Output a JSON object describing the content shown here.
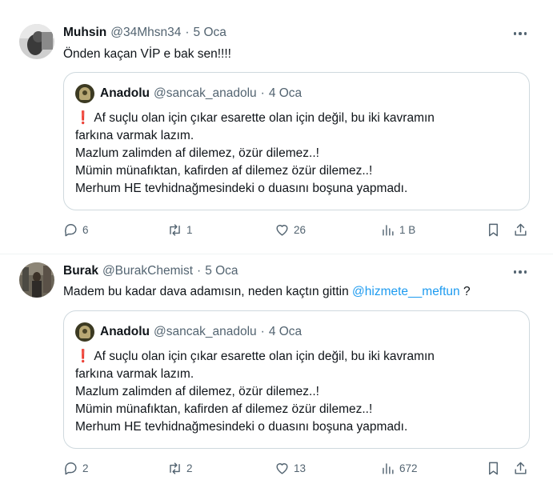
{
  "quoted": {
    "name": "Anadolu",
    "handle": "@sancak_anadolu",
    "date": "4 Oca",
    "lines": [
      "Af suçlu olan için çıkar esarette olan için değil, bu iki kavramın",
      "farkına varmak lazım.",
      "Mazlum zalimden af dilemez, özür dilemez..!",
      "Mümin münafıktan, kafirden af dilemez özür dilemez..!",
      "Merhum HE tevhidnağmesindeki o duasını boşuna yapmadı."
    ]
  },
  "tweets": [
    {
      "name": "Muhsin",
      "handle": "@34Mhsn34",
      "date": "5 Oca",
      "text": "Önden kaçan VİP e bak sen!!!!",
      "replies": "6",
      "reposts": "1",
      "likes": "26",
      "views": "1 B"
    },
    {
      "name": "Burak",
      "handle": "@BurakChemist",
      "date": "5 Oca",
      "text_before": "Madem bu kadar dava adamısın, neden kaçtın gittin",
      "mention": "@hizmete__meftun",
      "text_after": "?",
      "replies": "2",
      "reposts": "2",
      "likes": "13",
      "views": "672"
    }
  ],
  "icons": {
    "reply": "reply-icon",
    "repost": "repost-icon",
    "like": "heart-icon",
    "views": "views-icon",
    "bookmark": "bookmark-icon",
    "share": "share-icon",
    "more": "more-icon"
  },
  "colors": {
    "text": "#0f1419",
    "secondary": "#536471",
    "link": "#1d9bf0",
    "border": "#cfd9de",
    "alert": "#e0245e"
  }
}
